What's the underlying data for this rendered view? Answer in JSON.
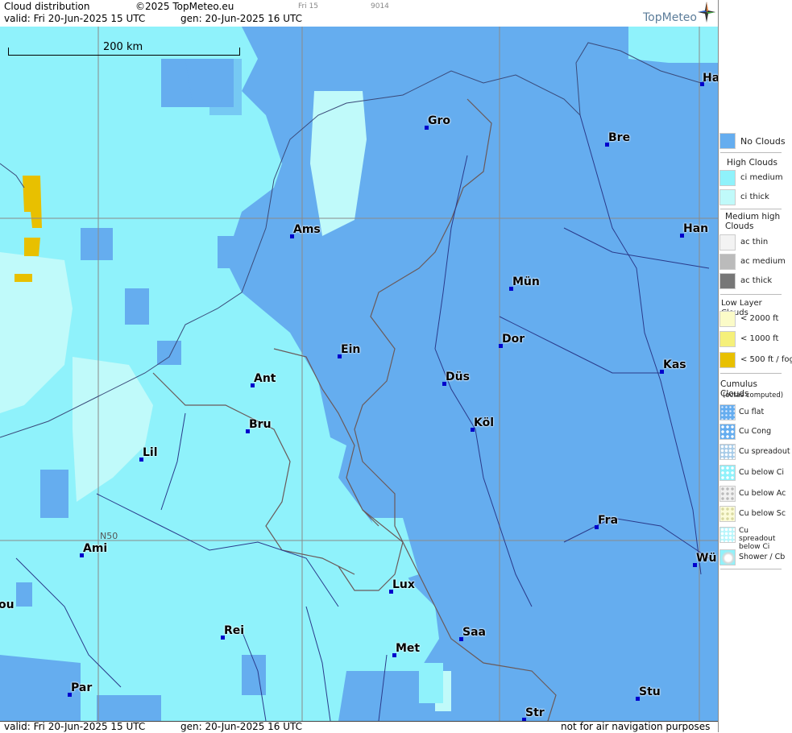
{
  "header": {
    "title": "Cloud distribution",
    "copyright": "©2025 TopMeteo.eu",
    "run_label": "Fri 15",
    "code": "9014",
    "valid": "valid:  Fri  20-Jun-2025  15 UTC",
    "gen": "gen: 20-Jun-2025 16 UTC",
    "brand": "TopMeteo"
  },
  "footer": {
    "valid": "valid:  Fri  20-Jun-2025  15 UTC",
    "gen": "gen: 20-Jun-2025 16 UTC",
    "disclaimer": "not for air navigation purposes"
  },
  "map": {
    "scale_label": "200 km",
    "lat_label": "N50",
    "cities": [
      {
        "name": "Ha"
      },
      {
        "name": "Gro"
      },
      {
        "name": "Bre"
      },
      {
        "name": "Ams"
      },
      {
        "name": "Han"
      },
      {
        "name": "Mün"
      },
      {
        "name": "Dor"
      },
      {
        "name": "Ein"
      },
      {
        "name": "Kas"
      },
      {
        "name": "Ant"
      },
      {
        "name": "Düs"
      },
      {
        "name": "Köl"
      },
      {
        "name": "Bru"
      },
      {
        "name": "Lil"
      },
      {
        "name": "Fra"
      },
      {
        "name": "Ami"
      },
      {
        "name": "Wü"
      },
      {
        "name": "Lux"
      },
      {
        "name": "ou"
      },
      {
        "name": "Rei"
      },
      {
        "name": "Saa"
      },
      {
        "name": "Met"
      },
      {
        "name": "Par"
      },
      {
        "name": "Stu"
      },
      {
        "name": "Str"
      }
    ]
  },
  "legend": {
    "no_clouds": "No Clouds",
    "high_title": "High Clouds",
    "ci_medium": "ci medium",
    "ci_thick": "ci thick",
    "medium_title": "Medium high Clouds",
    "ac_thin": "ac thin",
    "ac_medium": "ac medium",
    "ac_thick": "ac thick",
    "low_title": "Low Layer Clouds",
    "low_2000": "< 2000 ft",
    "low_1000": "< 1000 ft",
    "low_500": "< 500 ft / fog",
    "cu_title": "Cumulus Clouds",
    "cu_sub": "(octas computed)",
    "cu_flat": "Cu flat",
    "cu_cong": "Cu Cong",
    "cu_spreadout": "Cu spreadout",
    "cu_below_ci": "Cu below Ci",
    "cu_below_ac": "Cu below Ac",
    "cu_below_sc": "Cu below Sc",
    "cu_spreadout_below_ci": "Cu spreadout below Ci",
    "shower_cb": "Shower / Cb"
  },
  "colors": {
    "no_clouds": "#65adef",
    "ci_medium": "#8ff2fb",
    "ci_thick": "#c0fafa",
    "low_500": "#e8c000",
    "ac_thick": "#777777"
  }
}
